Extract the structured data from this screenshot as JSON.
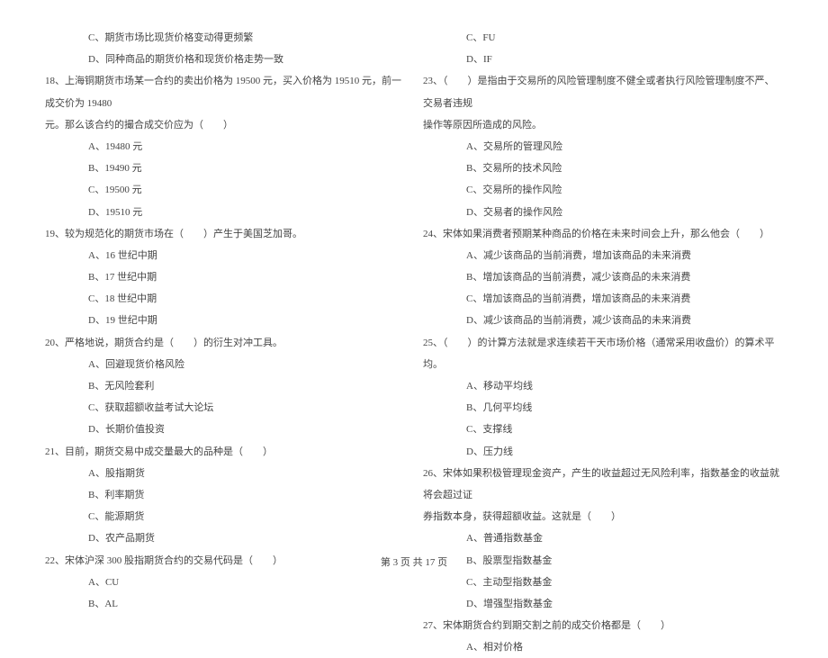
{
  "left": [
    {
      "cls": "indent-1",
      "text": "C、期货市场比现货价格变动得更频繁"
    },
    {
      "cls": "indent-1",
      "text": "D、同种商品的期货价格和现货价格走势一致"
    },
    {
      "cls": "indent-0",
      "text": "18、上海铜期货市场某一合约的卖出价格为 19500 元，买入价格为 19510 元，前一成交价为 19480"
    },
    {
      "cls": "indent-0",
      "text": "元。那么该合约的撮合成交价应为（　　）"
    },
    {
      "cls": "indent-1",
      "text": "A、19480 元"
    },
    {
      "cls": "indent-1",
      "text": "B、19490 元"
    },
    {
      "cls": "indent-1",
      "text": "C、19500 元"
    },
    {
      "cls": "indent-1",
      "text": "D、19510 元"
    },
    {
      "cls": "indent-0",
      "text": "19、较为规范化的期货市场在（　　）产生于美国芝加哥。"
    },
    {
      "cls": "indent-1",
      "text": "A、16 世纪中期"
    },
    {
      "cls": "indent-1",
      "text": "B、17 世纪中期"
    },
    {
      "cls": "indent-1",
      "text": "C、18 世纪中期"
    },
    {
      "cls": "indent-1",
      "text": "D、19 世纪中期"
    },
    {
      "cls": "indent-0",
      "text": "20、严格地说，期货合约是（　　）的衍生对冲工具。"
    },
    {
      "cls": "indent-1",
      "text": "A、回避现货价格风险"
    },
    {
      "cls": "indent-1",
      "text": "B、无风险套利"
    },
    {
      "cls": "indent-1",
      "text": "C、获取超额收益考试大论坛"
    },
    {
      "cls": "indent-1",
      "text": "D、长期价值投资"
    },
    {
      "cls": "indent-0",
      "text": "21、目前，期货交易中成交量最大的品种是（　　）"
    },
    {
      "cls": "indent-1",
      "text": "A、股指期货"
    },
    {
      "cls": "indent-1",
      "text": "B、利率期货"
    },
    {
      "cls": "indent-1",
      "text": "C、能源期货"
    },
    {
      "cls": "indent-1",
      "text": "D、农产品期货"
    },
    {
      "cls": "indent-0",
      "text": "22、宋体沪深 300 股指期货合约的交易代码是（　　）"
    },
    {
      "cls": "indent-1",
      "text": "A、CU"
    },
    {
      "cls": "indent-1",
      "text": "B、AL"
    }
  ],
  "right": [
    {
      "cls": "indent-1",
      "text": "C、FU"
    },
    {
      "cls": "indent-1",
      "text": "D、IF"
    },
    {
      "cls": "indent-0",
      "text": "23、（　　）是指由于交易所的风险管理制度不健全或者执行风险管理制度不严、交易者违规"
    },
    {
      "cls": "indent-0",
      "text": "操作等原因所造成的风险。"
    },
    {
      "cls": "indent-1",
      "text": "A、交易所的管理风险"
    },
    {
      "cls": "indent-1",
      "text": "B、交易所的技术风险"
    },
    {
      "cls": "indent-1",
      "text": "C、交易所的操作风险"
    },
    {
      "cls": "indent-1",
      "text": "D、交易者的操作风险"
    },
    {
      "cls": "indent-0",
      "text": "24、宋体如果消费者预期某种商品的价格在未来时间会上升，那么他会（　　）"
    },
    {
      "cls": "indent-1",
      "text": "A、减少该商品的当前消费，增加该商品的未来消费"
    },
    {
      "cls": "indent-1",
      "text": "B、增加该商品的当前消费，减少该商品的未来消费"
    },
    {
      "cls": "indent-1",
      "text": "C、增加该商品的当前消费，增加该商品的未来消费"
    },
    {
      "cls": "indent-1",
      "text": "D、减少该商品的当前消费，减少该商品的未来消费"
    },
    {
      "cls": "indent-0",
      "text": "25、（　　）的计算方法就是求连续若干天市场价格（通常采用收盘价）的算术平均。"
    },
    {
      "cls": "indent-1",
      "text": "A、移动平均线"
    },
    {
      "cls": "indent-1",
      "text": "B、几何平均线"
    },
    {
      "cls": "indent-1",
      "text": "C、支撑线"
    },
    {
      "cls": "indent-1",
      "text": "D、压力线"
    },
    {
      "cls": "indent-0",
      "text": "26、宋体如果积极管理现金资产，产生的收益超过无风险利率，指数基金的收益就将会超过证"
    },
    {
      "cls": "indent-0",
      "text": "券指数本身，获得超额收益。这就是（　　）"
    },
    {
      "cls": "indent-1",
      "text": "A、普通指数基金"
    },
    {
      "cls": "indent-1",
      "text": "B、股票型指数基金"
    },
    {
      "cls": "indent-1",
      "text": "C、主动型指数基金"
    },
    {
      "cls": "indent-1",
      "text": "D、增强型指数基金"
    },
    {
      "cls": "indent-0",
      "text": "27、宋体期货合约到期交割之前的成交价格都是（　　）"
    },
    {
      "cls": "indent-1",
      "text": "A、相对价格"
    }
  ],
  "footer": "第 3 页 共 17 页"
}
